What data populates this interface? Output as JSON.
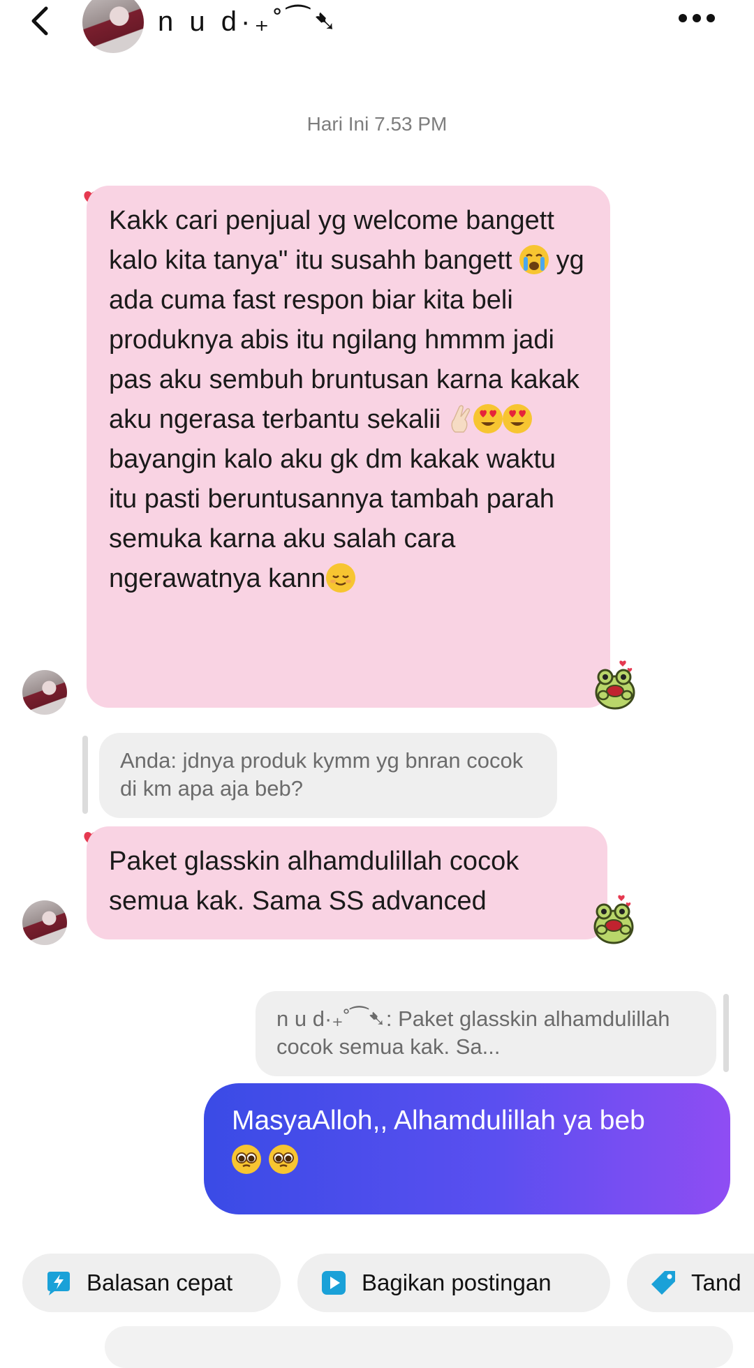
{
  "header": {
    "back_icon": "chevron-left-icon",
    "contact_name": "n u d·₊˚⁀➷",
    "more_icon": "more-horizontal-icon"
  },
  "thread": {
    "timestamp": "Hari Ini 7.53 PM",
    "msg1": {
      "seg1": "Kakk cari penjual yg welcome bangett kalo kita tanya\" itu susahh bangett ",
      "seg2": " yg ada cuma fast respon biar kita beli produknya abis itu ngilang hmmm jadi pas aku sembuh bruntusan karna kakak aku ngerasa terbantu sekalii ",
      "seg3": " bayangin kalo aku gk dm kakak waktu itu pasti beruntusannya tambah parah semuka karna aku salah cara ngerawatnya kann"
    },
    "reply_in": {
      "text": "Anda: jdnya produk kymm yg bnran cocok di km apa aja beb?"
    },
    "msg2": {
      "text": "Paket glasskin alhamdulillah cocok semua kak. Sama SS advanced"
    },
    "reply_out": {
      "text": "n u d·₊˚⁀➷: Paket glasskin alhamdulillah cocok semua kak. Sa..."
    },
    "msg3": {
      "text": "MasyaAlloh,, Alhamdulillah ya beb"
    }
  },
  "quick_actions": {
    "chip1": "Balasan cepat",
    "chip2": "Bagikan postingan",
    "chip3": "Tand"
  },
  "colors": {
    "incoming_bubble": "#f9d3e3",
    "outgoing_start": "#3a4be6",
    "outgoing_end": "#8f4df3",
    "reply_bg": "#efefef",
    "icon_accent": "#1aa1d8"
  }
}
